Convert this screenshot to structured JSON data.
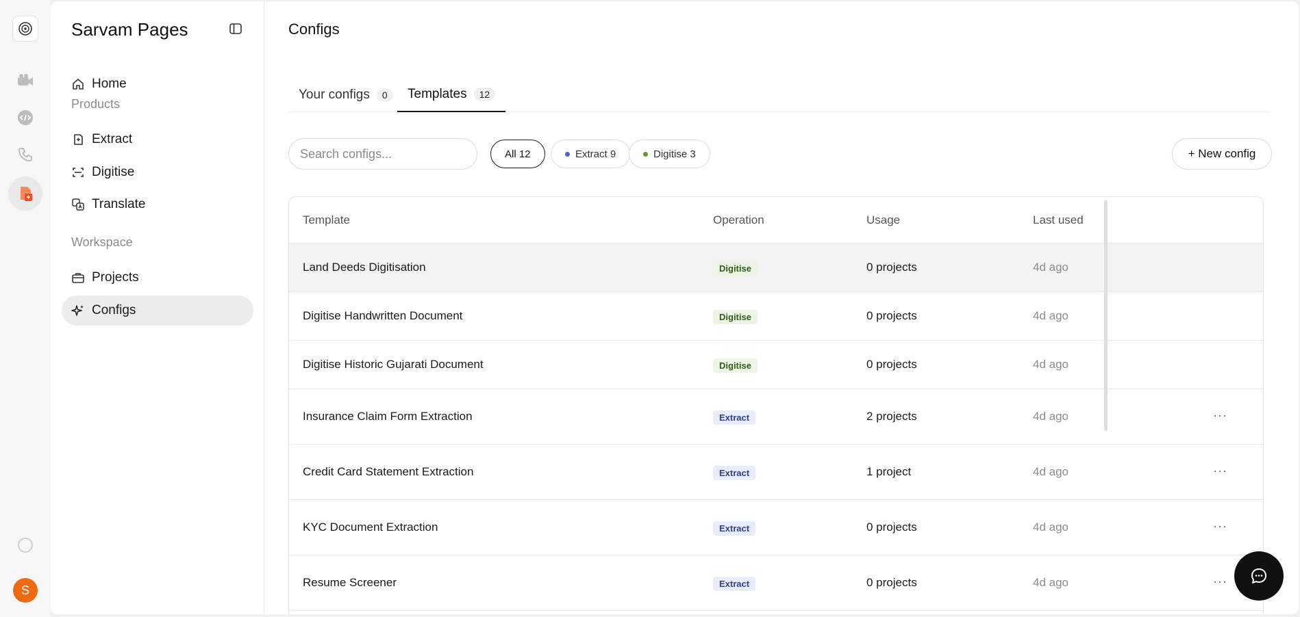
{
  "sidebar": {
    "brand": "Sarvam Pages",
    "home": "Home",
    "products_label": "Products",
    "products": [
      "Extract",
      "Digitise",
      "Translate"
    ],
    "workspace_label": "Workspace",
    "workspace": [
      "Projects",
      "Configs"
    ],
    "active_item": "Configs",
    "avatar_initial": "S"
  },
  "main": {
    "title": "Configs",
    "tabs": [
      {
        "label": "Your configs",
        "count": "0"
      },
      {
        "label": "Templates",
        "count": "12"
      }
    ],
    "active_tab": "Templates",
    "search_placeholder": "Search configs...",
    "filters": [
      {
        "label": "All 12",
        "color": ""
      },
      {
        "label": "Extract 9",
        "color": "#4f63d8"
      },
      {
        "label": "Digitise 3",
        "color": "#5c9a2f"
      }
    ],
    "new_button": "+ New config"
  },
  "table": {
    "headers": [
      "Template",
      "Operation",
      "Usage",
      "Last used"
    ],
    "rows": [
      {
        "template": "Land Deeds Digitisation",
        "operation": "Digitise",
        "usage": "0 projects",
        "last_used": "4d ago"
      },
      {
        "template": "Digitise Handwritten Document",
        "operation": "Digitise",
        "usage": "0 projects",
        "last_used": "4d ago"
      },
      {
        "template": "Digitise Historic Gujarati Document",
        "operation": "Digitise",
        "usage": "0 projects",
        "last_used": "4d ago"
      },
      {
        "template": "Insurance Claim Form Extraction",
        "operation": "Extract",
        "usage": "2 projects",
        "last_used": "4d ago",
        "more": "···"
      },
      {
        "template": "Credit Card Statement Extraction",
        "operation": "Extract",
        "usage": "1 project",
        "last_used": "4d ago",
        "more": "···"
      },
      {
        "template": "KYC Document Extraction",
        "operation": "Extract",
        "usage": "0 projects",
        "last_used": "4d ago",
        "more": "···"
      },
      {
        "template": "Resume Screener",
        "operation": "Extract",
        "usage": "0 projects",
        "last_used": "4d ago",
        "more": "···"
      }
    ]
  },
  "colors": {
    "accent_orange": "#ee6a12",
    "digitise_badge_bg": "#edf6e6",
    "extract_badge_bg": "#e9edfb"
  },
  "icons": {
    "rail": [
      "sarvam-logo-icon",
      "camera-icon",
      "code-icon",
      "phone-icon",
      "pages-icon",
      "status-circle-icon"
    ],
    "nav": [
      "home-icon",
      "extract-icon",
      "digitise-icon",
      "translate-icon",
      "briefcase-icon",
      "sparkle-icon"
    ]
  }
}
